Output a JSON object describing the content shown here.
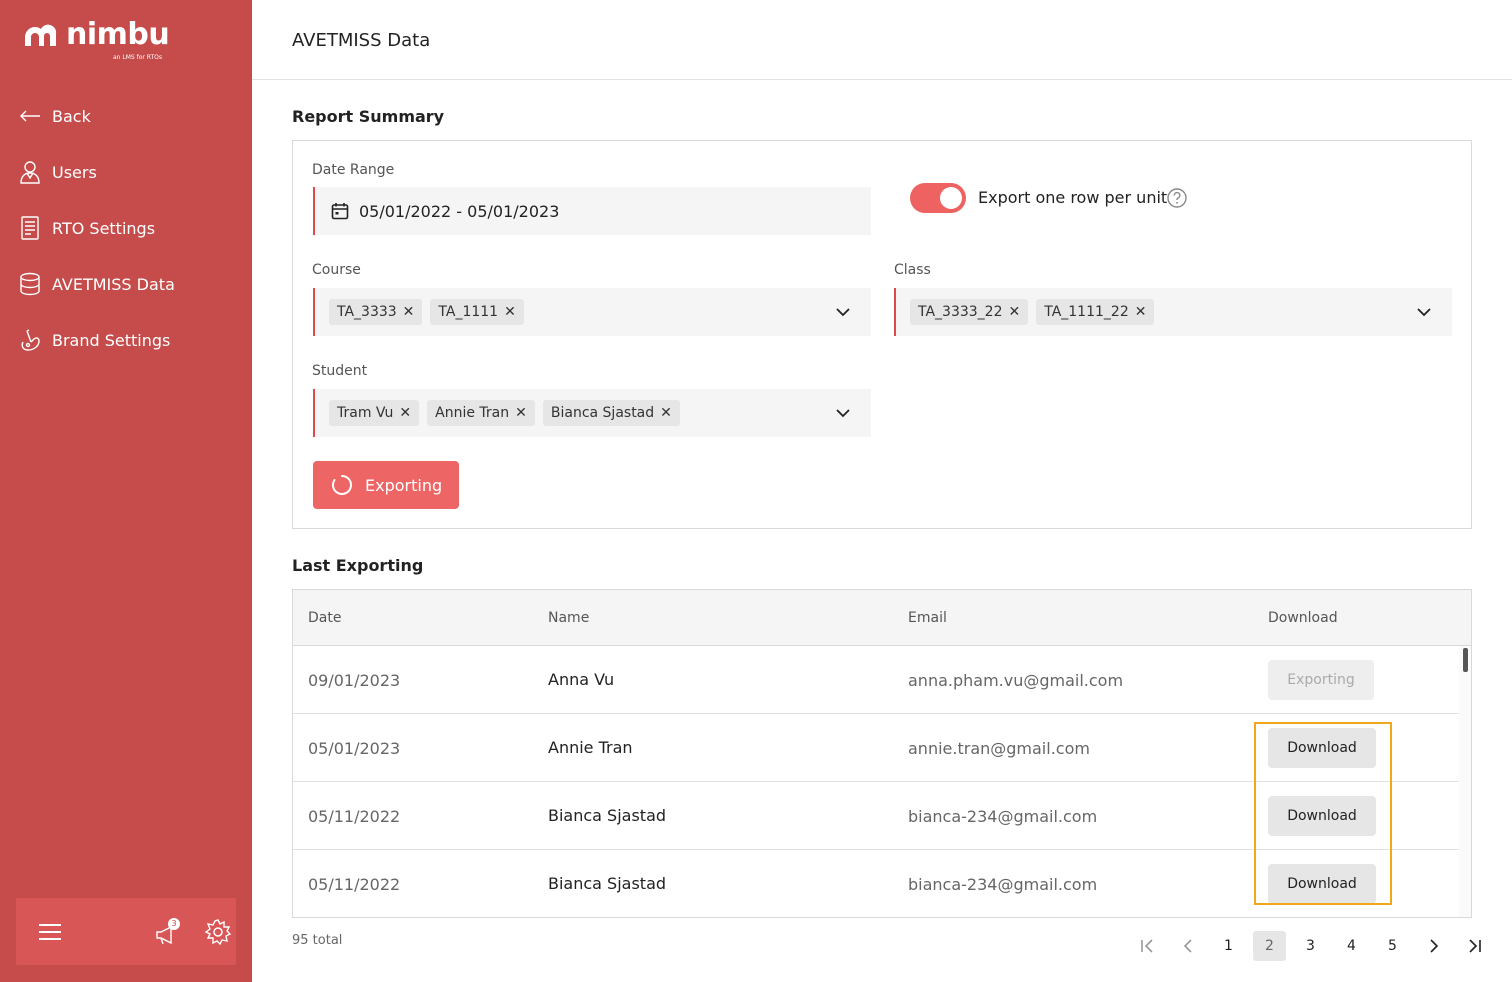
{
  "brand": {
    "name": "nimbu",
    "tagline": "an LMS for RTOs",
    "accent": "#c64c4c"
  },
  "sidebar": {
    "items": [
      {
        "label": "Back",
        "icon": "arrow-left-icon"
      },
      {
        "label": "Users",
        "icon": "user-icon"
      },
      {
        "label": "RTO Settings",
        "icon": "document-icon"
      },
      {
        "label": "AVETMISS Data",
        "icon": "database-icon"
      },
      {
        "label": "Brand Settings",
        "icon": "brand-icon"
      }
    ],
    "footer": {
      "notification_count": "3"
    }
  },
  "header": {
    "title": "AVETMISS Data"
  },
  "report_summary": {
    "title": "Report Summary",
    "date_range": {
      "label": "Date Range",
      "value": "05/01/2022 - 05/01/2023"
    },
    "export_toggle": {
      "label": "Export one row per unit",
      "on": true
    },
    "course": {
      "label": "Course",
      "chips": [
        "TA_3333",
        "TA_1111"
      ]
    },
    "class": {
      "label": "Class",
      "chips": [
        "TA_3333_22",
        "TA_1111_22"
      ]
    },
    "student": {
      "label": "Student",
      "chips": [
        "Tram Vu",
        "Annie Tran",
        "Bianca Sjastad"
      ]
    },
    "export_button": "Exporting"
  },
  "last_exporting": {
    "title": "Last Exporting",
    "columns": [
      "Date",
      "Name",
      "Email",
      "Download"
    ],
    "rows": [
      {
        "date": "09/01/2023",
        "name": "Anna Vu",
        "email": "anna.pham.vu@gmail.com",
        "action": "Exporting"
      },
      {
        "date": "05/01/2023",
        "name": "Annie Tran",
        "email": "annie.tran@gmail.com",
        "action": "Download"
      },
      {
        "date": "05/11/2022",
        "name": "Bianca Sjastad",
        "email": "bianca-234@gmail.com",
        "action": "Download"
      },
      {
        "date": "05/11/2022",
        "name": "Bianca Sjastad",
        "email": "bianca-234@gmail.com",
        "action": "Download"
      }
    ],
    "total": "95 total",
    "pagination": {
      "pages": [
        "1",
        "2",
        "3",
        "4",
        "5"
      ],
      "current": "2"
    }
  }
}
